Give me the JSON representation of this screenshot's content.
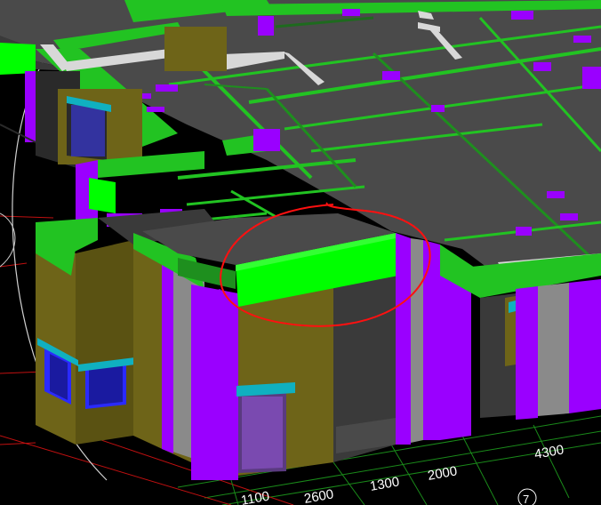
{
  "viewport": {
    "label": "3D building model view",
    "colors": {
      "background": "#000000",
      "slab_top": "#4a4a4a",
      "slab_side": "#3a3a3a",
      "beam_green": "#22c322",
      "beam_green_bright": "#00ff00",
      "beam_green_dark": "#1e8f1e",
      "column_purple": "#9a00ff",
      "column_purple_dark": "#6a00c0",
      "wall_olive": "#6e6418",
      "wall_olive_dark": "#5a5212",
      "wall_gray": "#8a8a8a",
      "window_blue": "#2a2aff",
      "window_cyan": "#10b0c0",
      "grid_green": "#1a8a1a",
      "grid_red": "#c01010",
      "circle_line": "#d0d0d0",
      "annotation_red": "#ff1010"
    }
  },
  "dimensions": [
    {
      "label": "1100"
    },
    {
      "label": "2600"
    },
    {
      "label": "1300"
    },
    {
      "label": "2000"
    },
    {
      "label": "4300"
    }
  ],
  "axis_marker": {
    "label": "7"
  },
  "annotation": {
    "shape": "freehand-circle",
    "color": "#ff1010"
  }
}
